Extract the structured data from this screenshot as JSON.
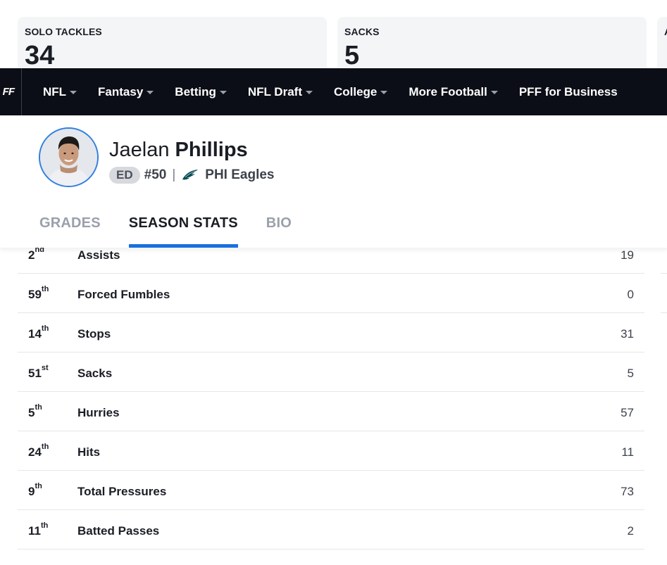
{
  "stat_cards": [
    {
      "label": "SOLO TACKLES",
      "value": "34"
    },
    {
      "label": "SACKS",
      "value": "5"
    },
    {
      "label": "A",
      "value": ""
    }
  ],
  "nav": {
    "logo": "FF",
    "items": [
      {
        "label": "NFL",
        "dropdown": true
      },
      {
        "label": "Fantasy",
        "dropdown": true
      },
      {
        "label": "Betting",
        "dropdown": true
      },
      {
        "label": "NFL Draft",
        "dropdown": true
      },
      {
        "label": "College",
        "dropdown": true
      },
      {
        "label": "More Football",
        "dropdown": true
      },
      {
        "label": "PFF for Business",
        "dropdown": false
      }
    ]
  },
  "player": {
    "first_name": "Jaelan",
    "last_name": "Phillips",
    "position": "ED",
    "number": "#50",
    "separator": "|",
    "team": "PHI Eagles"
  },
  "tabs": [
    {
      "label": "GRADES",
      "active": false
    },
    {
      "label": "SEASON STATS",
      "active": true
    },
    {
      "label": "BIO",
      "active": false
    }
  ],
  "stats": [
    {
      "rank": "2",
      "suffix": "nd",
      "name": "Assists",
      "value": "19"
    },
    {
      "rank": "59",
      "suffix": "th",
      "name": "Forced Fumbles",
      "value": "0"
    },
    {
      "rank": "14",
      "suffix": "th",
      "name": "Stops",
      "value": "31"
    },
    {
      "rank": "51",
      "suffix": "st",
      "name": "Sacks",
      "value": "5"
    },
    {
      "rank": "5",
      "suffix": "th",
      "name": "Hurries",
      "value": "57"
    },
    {
      "rank": "24",
      "suffix": "th",
      "name": "Hits",
      "value": "11"
    },
    {
      "rank": "9",
      "suffix": "th",
      "name": "Total Pressures",
      "value": "73"
    },
    {
      "rank": "11",
      "suffix": "th",
      "name": "Batted Passes",
      "value": "2"
    }
  ],
  "colors": {
    "nav_bg": "#0b0e16",
    "tab_accent": "#1a6fe0",
    "avatar_border": "#2f7fe0",
    "eagles_green": "#004c54"
  },
  "icons": [
    "caret-down-icon",
    "eagles-logo-icon",
    "player-avatar"
  ]
}
